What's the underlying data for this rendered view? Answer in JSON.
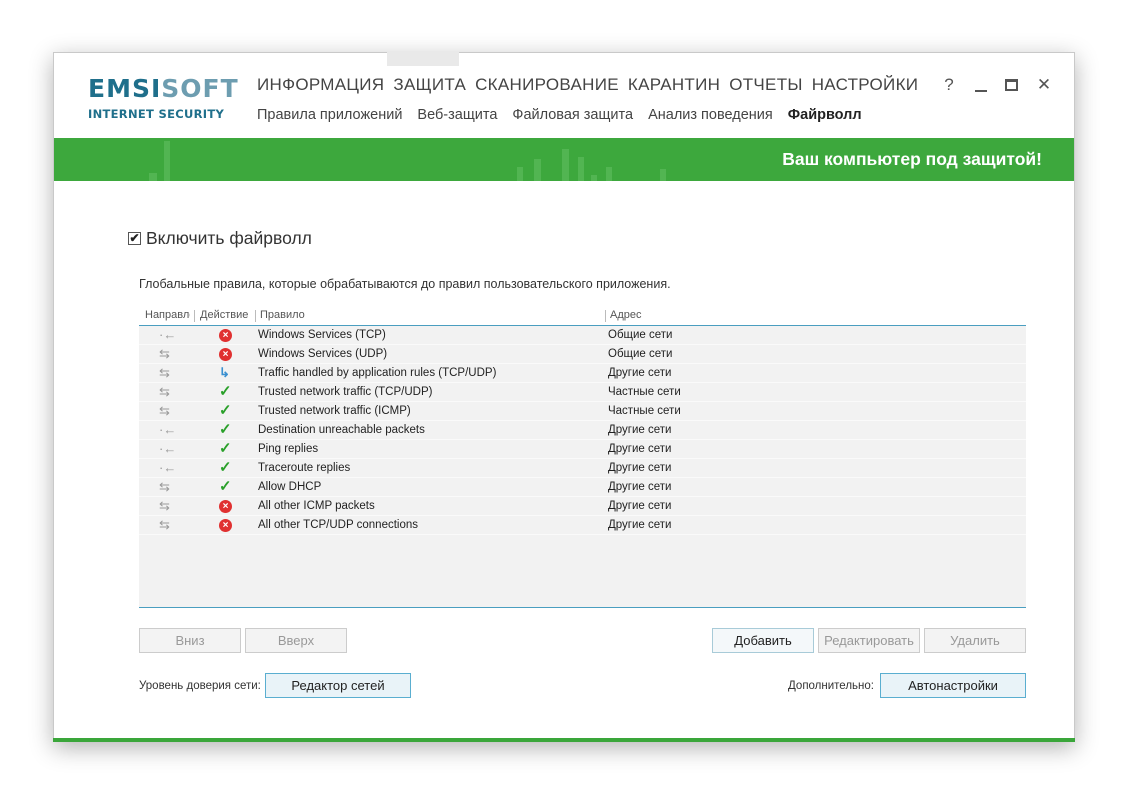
{
  "brand": {
    "logo_part1": "EMSI",
    "logo_part2": "SOFT",
    "logo_sub": "INTERNET SECURITY"
  },
  "main_nav": [
    "ИНФОРМАЦИЯ",
    "ЗАЩИТА",
    "СКАНИРОВАНИЕ",
    "КАРАНТИН",
    "ОТЧЕТЫ",
    "НАСТРОЙКИ"
  ],
  "sub_nav": [
    {
      "label": "Правила приложений",
      "active": false
    },
    {
      "label": "Веб-защита",
      "active": false
    },
    {
      "label": "Файловая защита",
      "active": false
    },
    {
      "label": "Анализ поведения",
      "active": false
    },
    {
      "label": "Файрволл",
      "active": true
    }
  ],
  "window_controls": {
    "help": "?"
  },
  "banner": {
    "status_text": "Ваш компьютер под защитой!",
    "color": "#3da83d"
  },
  "firewall": {
    "enable_label": "Включить файрволл",
    "enabled": true,
    "check_mark": "✔",
    "description": "Глобальные правила, которые обрабатываются до правил пользовательского приложения."
  },
  "table": {
    "columns": {
      "direction": "Направление",
      "action": "Действие",
      "rule": "Правило",
      "address": "Адрес"
    },
    "rows": [
      {
        "direction": "in",
        "action": "block",
        "rule": "Windows Services (TCP)",
        "address": "Общие сети"
      },
      {
        "direction": "both",
        "action": "block",
        "rule": "Windows Services (UDP)",
        "address": "Общие сети"
      },
      {
        "direction": "both",
        "action": "app",
        "rule": "Traffic handled by application rules (TCP/UDP)",
        "address": "Другие сети"
      },
      {
        "direction": "both",
        "action": "allow",
        "rule": "Trusted network traffic (TCP/UDP)",
        "address": "Частные сети"
      },
      {
        "direction": "both",
        "action": "allow",
        "rule": "Trusted network traffic (ICMP)",
        "address": "Частные сети"
      },
      {
        "direction": "in",
        "action": "allow",
        "rule": "Destination unreachable packets",
        "address": "Другие сети"
      },
      {
        "direction": "in",
        "action": "allow",
        "rule": "Ping replies",
        "address": "Другие сети"
      },
      {
        "direction": "in",
        "action": "allow",
        "rule": "Traceroute replies",
        "address": "Другие сети"
      },
      {
        "direction": "both",
        "action": "allow",
        "rule": "Allow DHCP",
        "address": "Другие сети"
      },
      {
        "direction": "both",
        "action": "block",
        "rule": "All other ICMP packets",
        "address": "Другие сети"
      },
      {
        "direction": "both",
        "action": "block",
        "rule": "All other TCP/UDP connections",
        "address": "Другие сети"
      }
    ]
  },
  "buttons": {
    "down": "Вниз",
    "up": "Вверх",
    "add": "Добавить",
    "edit": "Редактировать",
    "delete": "Удалить",
    "network_editor": "Редактор сетей",
    "auto_settings": "Автонастройки"
  },
  "footer": {
    "trust_label": "Уровень доверия сети:",
    "extra_label": "Дополнительно:"
  }
}
